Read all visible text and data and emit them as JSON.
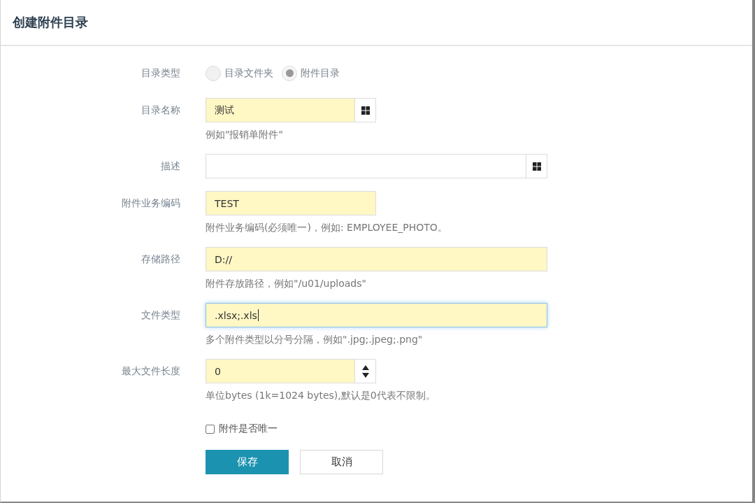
{
  "title": "创建附件目录",
  "fields": [
    {
      "kind": "radio",
      "label": "目录类型",
      "options": [
        {
          "label": "目录文件夹",
          "selected": false
        },
        {
          "label": "附件目录",
          "selected": true
        }
      ]
    },
    {
      "kind": "text",
      "label": "目录名称",
      "value": "测试",
      "required": true,
      "focused": false,
      "wide": false,
      "picker": true,
      "hint": "例如\"报销单附件\""
    },
    {
      "kind": "text",
      "label": "描述",
      "required": false,
      "focused": false,
      "wide": true,
      "picker": true
    },
    {
      "kind": "text",
      "label": "附件业务编码",
      "value": "TEST",
      "required": true,
      "focused": false,
      "wide": false,
      "picker": false,
      "hint": "附件业务编码(必须唯一)，例如: EMPLOYEE_PHOTO。"
    },
    {
      "kind": "text",
      "label": "存储路径",
      "value": "D://",
      "required": true,
      "focused": false,
      "wide": true,
      "picker": false,
      "hint": "附件存放路径，例如\"/u01/uploads\""
    },
    {
      "kind": "text",
      "label": "文件类型",
      "value": ".xlsx;.xls",
      "required": true,
      "focused": true,
      "wide": true,
      "picker": false,
      "hint": "多个附件类型以分号分隔，例如\".jpg;.jpeg;.png\""
    },
    {
      "kind": "number",
      "label": "最大文件长度",
      "value": "0",
      "required": true,
      "focused": false,
      "wide": false,
      "hint": "单位bytes (1k=1024 bytes),默认是0代表不限制。"
    }
  ],
  "checkbox": {
    "label": "附件是否唯一",
    "checked": false
  },
  "buttons": [
    {
      "label": "保存",
      "kind": "primary"
    },
    {
      "label": "取消",
      "kind": "default"
    }
  ]
}
